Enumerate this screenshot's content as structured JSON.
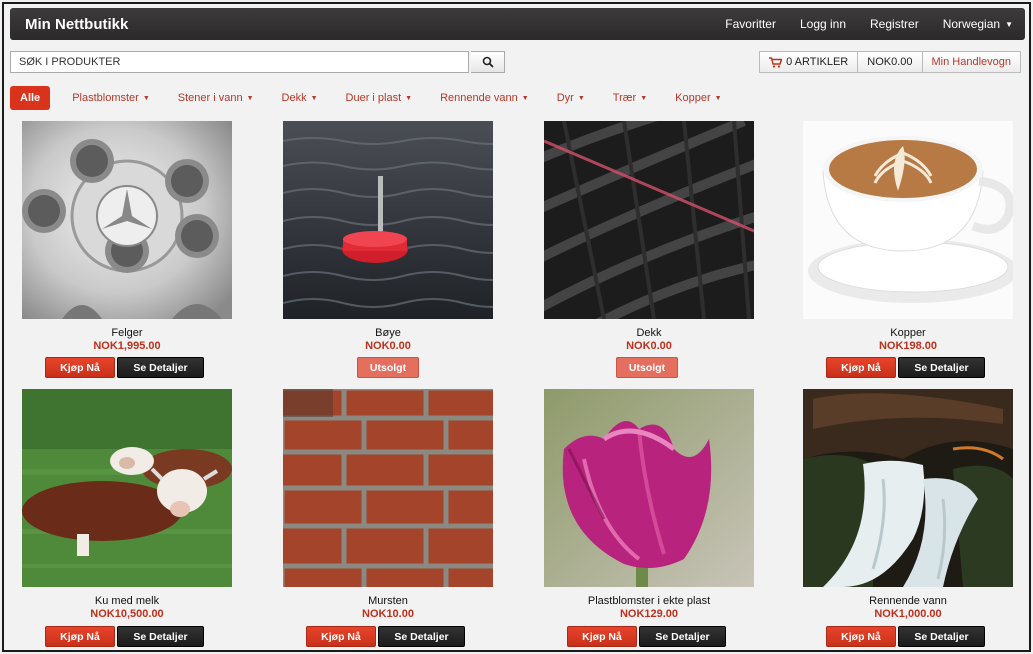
{
  "header": {
    "brand": "Min Nettbutikk",
    "nav": [
      {
        "label": "Favoritter",
        "caret": false
      },
      {
        "label": "Logg inn",
        "caret": false
      },
      {
        "label": "Registrer",
        "caret": false
      },
      {
        "label": "Norwegian",
        "caret": true
      }
    ]
  },
  "search": {
    "placeholder": "SØK I PRODUKTER"
  },
  "cart": {
    "items": "0 ARTIKLER",
    "total": "NOK0.00",
    "link": "Min Handlevogn"
  },
  "categories": {
    "active": "Alle",
    "items": [
      "Plastblomster",
      "Stener i vann",
      "Dekk",
      "Duer i plast",
      "Rennende vann",
      "Dyr",
      "Trær",
      "Kopper"
    ]
  },
  "buttons": {
    "buy": "Kjøp Nå",
    "details": "Se Detaljer",
    "sold": "Utsolgt"
  },
  "products": [
    {
      "name": "Felger",
      "price": "NOK1,995.00",
      "status": "available",
      "image": "alloy-wheel"
    },
    {
      "name": "Bøye",
      "price": "NOK0.00",
      "status": "sold-out",
      "image": "red-buoy-in-water"
    },
    {
      "name": "Dekk",
      "price": "NOK0.00",
      "status": "sold-out",
      "image": "tire-tread"
    },
    {
      "name": "Kopper",
      "price": "NOK198.00",
      "status": "available",
      "image": "latte-cup"
    },
    {
      "name": "Ku med melk",
      "price": "NOK10,500.00",
      "status": "available",
      "image": "cows-in-field"
    },
    {
      "name": "Mursten",
      "price": "NOK10.00",
      "status": "available",
      "image": "brick-wall"
    },
    {
      "name": "Plastblomster i ekte plast",
      "price": "NOK129.00",
      "status": "available",
      "image": "purple-tulip"
    },
    {
      "name": "Rennende vann",
      "price": "NOK1,000.00",
      "status": "available",
      "image": "waterfall"
    }
  ],
  "colors": {
    "accent": "#d9331b",
    "price": "#c0301c",
    "topbar": "#333131"
  }
}
